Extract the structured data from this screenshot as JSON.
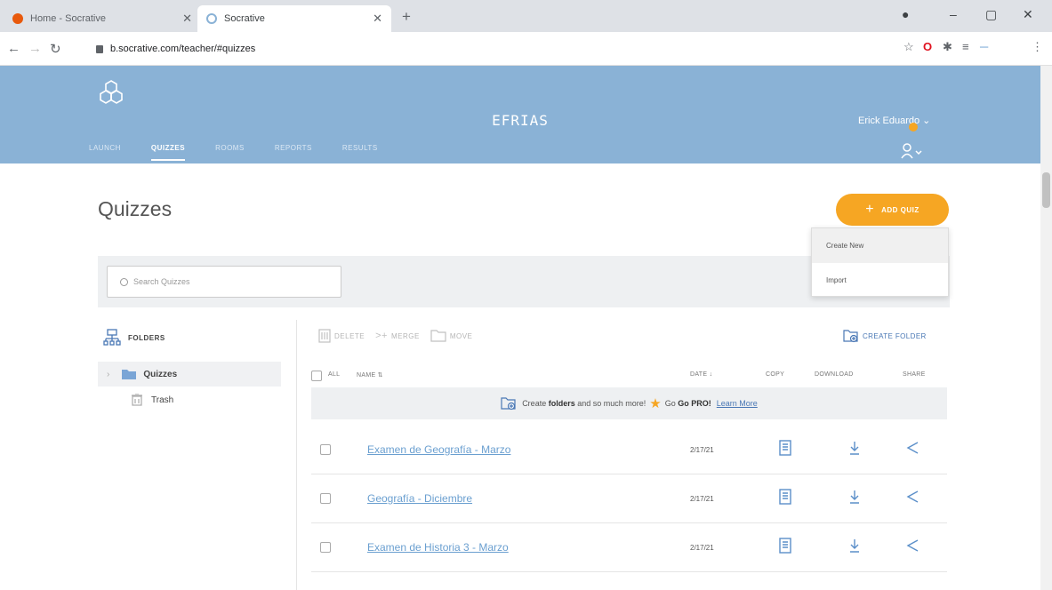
{
  "browser": {
    "tabs": [
      {
        "title": "Home - Socrative",
        "active": false
      },
      {
        "title": "Socrative",
        "active": true
      }
    ],
    "url": "b.socrative.com/teacher/#quizzes"
  },
  "header": {
    "room_name": "EFRIAS",
    "user_name": "Erick Eduardo ⌄",
    "nav": [
      "Launch",
      "Quizzes",
      "Rooms",
      "Reports",
      "Results"
    ],
    "active_nav": "Quizzes"
  },
  "page": {
    "title": "Quizzes",
    "add_quiz_label": "ADD QUIZ",
    "add_quiz_menu": [
      "Create New",
      "Import"
    ],
    "search_placeholder": "Search Quizzes"
  },
  "sidebar": {
    "heading": "FOLDERS",
    "items": [
      {
        "label": "Quizzes",
        "selected": true
      },
      {
        "label": "Trash",
        "selected": false
      }
    ]
  },
  "toolbar": {
    "delete": "DELETE",
    "merge": "MERGE",
    "move": "MOVE",
    "create_folder": "CREATE FOLDER"
  },
  "table": {
    "headers": {
      "all": "ALL",
      "name": "NAME ⇅",
      "date": "DATE ↓",
      "copy": "COPY",
      "download": "DOWNLOAD",
      "share": "SHARE"
    },
    "promo": {
      "prefix": "Create",
      "bold": "folders",
      "middle": "and so much more!",
      "go_pro": "Go PRO!",
      "learn": "Learn More"
    },
    "rows": [
      {
        "name": "Examen de Geografía - Marzo",
        "date": "2/17/21"
      },
      {
        "name": "Geografía - Diciembre",
        "date": "2/17/21"
      },
      {
        "name": "Examen de Historia 3 - Marzo",
        "date": "2/17/21"
      }
    ]
  },
  "colors": {
    "header": "#8ab2d6",
    "accent": "#f6a623",
    "link": "#6a9fd0"
  }
}
